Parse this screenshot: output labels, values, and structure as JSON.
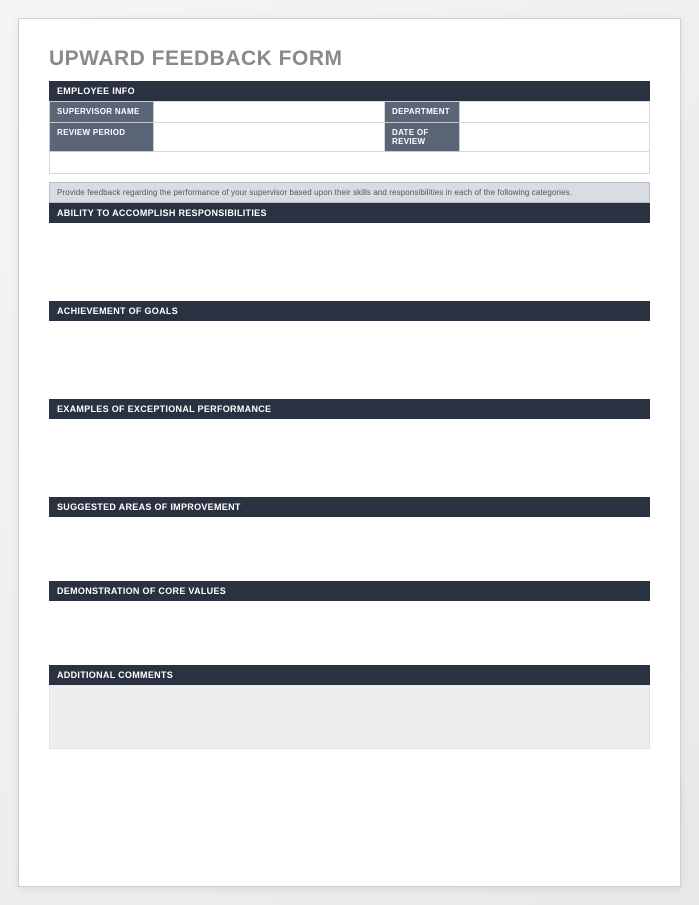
{
  "title": "UPWARD FEEDBACK FORM",
  "employee_info_header": "EMPLOYEE INFO",
  "fields": {
    "supervisor_name_label": "SUPERVISOR NAME",
    "department_label": "DEPARTMENT",
    "review_period_label": "REVIEW PERIOD",
    "date_of_review_label": "DATE OF REVIEW",
    "supervisor_name_value": "",
    "department_value": "",
    "review_period_value": "",
    "date_of_review_value": ""
  },
  "instruction": "Provide feedback regarding the performance of your supervisor based upon their skills and responsibilities in each of the following categories.",
  "sections": {
    "s1": "ABILITY TO ACCOMPLISH RESPONSIBILITIES",
    "s2": "ACHIEVEMENT OF GOALS",
    "s3": "EXAMPLES OF EXCEPTIONAL PERFORMANCE",
    "s4": "SUGGESTED AREAS OF IMPROVEMENT",
    "s5": "DEMONSTRATION OF CORE VALUES",
    "s6": "ADDITIONAL COMMENTS"
  }
}
